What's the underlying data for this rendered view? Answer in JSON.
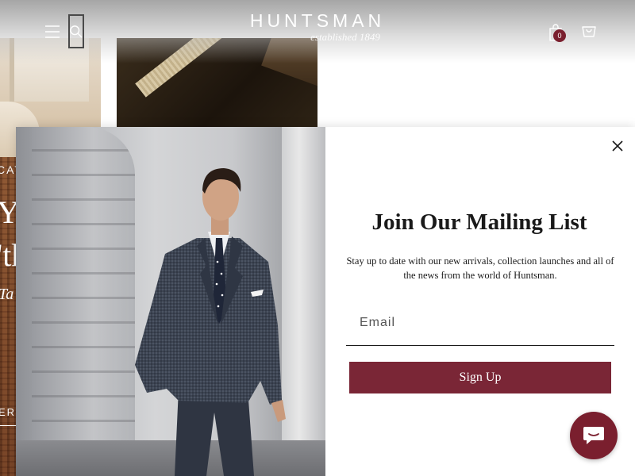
{
  "header": {
    "logo_text": "HUNTSMAN",
    "logo_tagline": "established 1849",
    "cart_count": "0",
    "menu_icon": "menu-icon",
    "search_icon": "search-icon",
    "bag_icon": "shopping-bag-icon",
    "cart_icon": "cart-icon"
  },
  "hero": {
    "eyebrow": "CAT",
    "line1": "Y",
    "line2": "'th",
    "subline": "Ta",
    "cta": "ER N"
  },
  "modal": {
    "title": "Join Our Mailing List",
    "description": "Stay up to date with our new arrivals, collection launches and all of the news from the world of Huntsman.",
    "email_placeholder": "Email",
    "email_value": "",
    "signup_label": "Sign Up",
    "close_icon": "close-icon",
    "image": "man-in-grey-suit-photo"
  },
  "chat": {
    "icon": "chat-icon"
  },
  "colors": {
    "brand": "#7a2636",
    "badge": "#7a1f2e",
    "text": "#1a1a1a",
    "white": "#ffffff"
  }
}
